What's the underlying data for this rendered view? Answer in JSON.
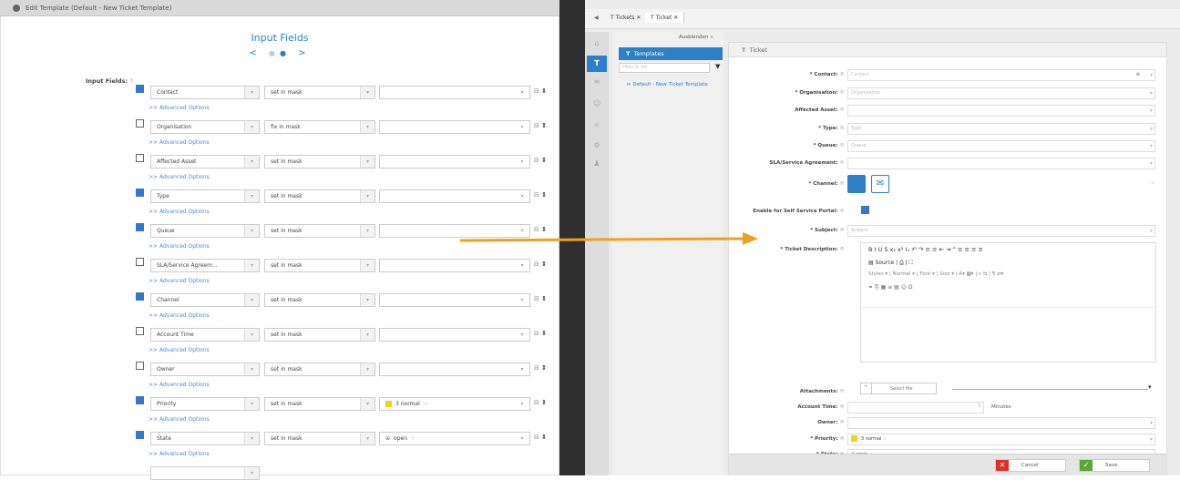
{
  "left": {
    "title": "Edit Template (Default - New Ticket Template)",
    "section_title": "Input Fields",
    "nav": {
      "prev": "<",
      "next": ">"
    },
    "input_fields_label": "Input Fields:",
    "help": "?",
    "advanced": ">> Advanced Options",
    "rows": [
      {
        "field": "Contact",
        "checked": true,
        "mode": "set in mask",
        "value": ""
      },
      {
        "field": "Organisation",
        "checked": false,
        "mode": "fix in mask",
        "value": ""
      },
      {
        "field": "Affected Asset",
        "checked": false,
        "mode": "set in mask",
        "value": ""
      },
      {
        "field": "Type",
        "checked": true,
        "mode": "set in mask",
        "value": ""
      },
      {
        "field": "Queue",
        "checked": true,
        "mode": "set in mask",
        "value": ""
      },
      {
        "field": "SLA/Service Agreem...",
        "checked": false,
        "mode": "set in mask",
        "value": ""
      },
      {
        "field": "Channel",
        "checked": true,
        "mode": "set in mask",
        "value": ""
      },
      {
        "field": "Account Time",
        "checked": false,
        "mode": "set in mask",
        "value": ""
      },
      {
        "field": "Owner",
        "checked": false,
        "mode": "set in mask",
        "value": ""
      },
      {
        "field": "Priority",
        "checked": true,
        "mode": "set in mask",
        "value": "3 normal"
      },
      {
        "field": "State",
        "checked": true,
        "mode": "set in mask",
        "value": "open"
      }
    ]
  },
  "right": {
    "tabs": [
      "Tickets",
      "Ticket"
    ],
    "sidebar_toggle": "Ausblenden",
    "templates_title": "Templates",
    "templates_filter": "Filter in list",
    "template_item": "Default - New Ticket Template",
    "form_title": "Ticket",
    "fields": {
      "contact": {
        "label": "* Contact:",
        "placeholder": "Contact"
      },
      "organisation": {
        "label": "* Organisation:",
        "placeholder": "Organisation"
      },
      "asset": {
        "label": "Affected Asset:",
        "placeholder": ""
      },
      "type": {
        "label": "* Type:",
        "placeholder": "Type"
      },
      "queue": {
        "label": "* Queue:",
        "placeholder": "Queue"
      },
      "sla": {
        "label": "SLA/Service Agreement:",
        "placeholder": ""
      },
      "channel": {
        "label": "* Channel:"
      },
      "selfservice": {
        "label": "Enable for Self Service Portal:"
      },
      "subject": {
        "label": "* Subject:",
        "placeholder": "Subject"
      },
      "description": {
        "label": "* Ticket Description:"
      },
      "attachments": {
        "label": "Attachments:",
        "button": "Select file"
      },
      "accounttime": {
        "label": "Account Time:",
        "unit": "Minutes"
      },
      "owner": {
        "label": "Owner:"
      },
      "priority": {
        "label": "* Priority:",
        "value": "3 normal"
      },
      "state": {
        "label": "* State:",
        "value": "open"
      }
    },
    "editor": {
      "row1": "B I U S x₂ x² Iₓ ↶ ↷ ≡ ≡ ⇤ ⇥ ” ≡ ≡ ≡ ≡",
      "source": "Source",
      "styles": "Styles",
      "format": "Normal",
      "font": "Font",
      "size": "Size"
    },
    "cancel": "Cancel",
    "save": "Save"
  },
  "colors": {
    "accent": "#2d7fc7",
    "arrow": "#f0a020",
    "cancel": "#d9322b",
    "save": "#5aa83a"
  }
}
